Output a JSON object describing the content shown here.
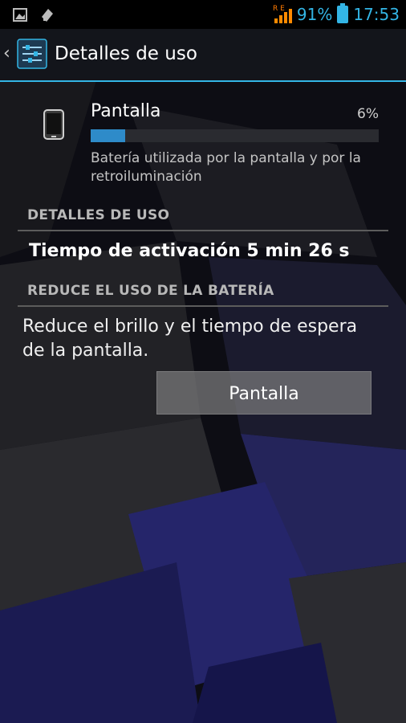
{
  "status_bar": {
    "network_label": "R E",
    "battery_percent": "91%",
    "time": "17:53",
    "accent_color": "#33b5e5"
  },
  "action_bar": {
    "title": "Detalles de uso",
    "up_icon": "chevron-left-icon",
    "app_icon": "settings-sliders-icon"
  },
  "item": {
    "title": "Pantalla",
    "percent": "6%",
    "progress_fraction": 0.12,
    "description": "Batería utilizada por la pantalla y por la retroiluminación",
    "icon": "phone-icon"
  },
  "usage_section": {
    "header": "DETALLES DE USO",
    "line": "Tiempo de activación 5 min 26 s"
  },
  "reduce_section": {
    "header": "REDUCE EL USO DE LA BATERÍA",
    "text": "Reduce el brillo y el tiempo de espera de la pantalla.",
    "button_label": "Pantalla"
  }
}
